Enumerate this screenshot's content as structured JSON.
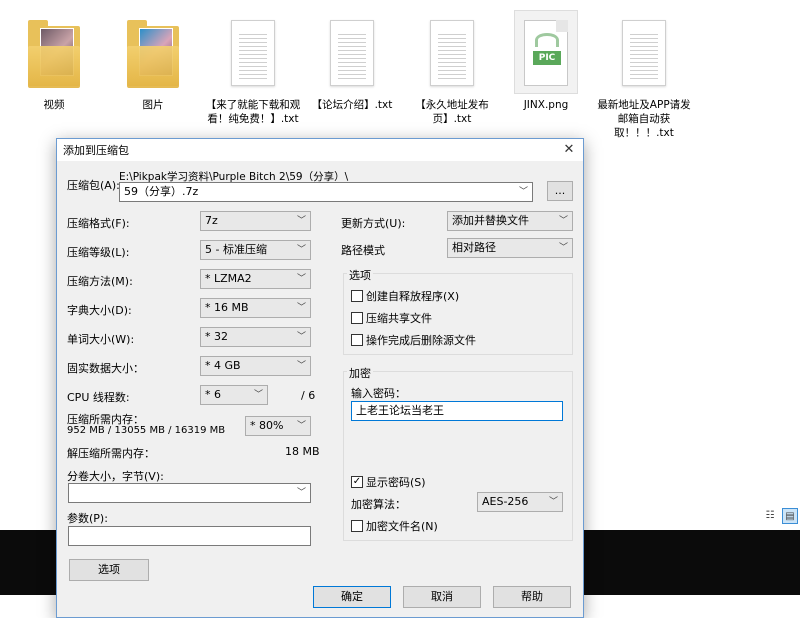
{
  "desktop": {
    "files": [
      {
        "name": "视频",
        "type": "folder"
      },
      {
        "name": "图片",
        "type": "folder"
      },
      {
        "name": "【来了就能下载和观看！纯免费！】.txt",
        "type": "txt"
      },
      {
        "name": "【论坛介绍】.txt",
        "type": "txt"
      },
      {
        "name": "【永久地址发布页】.txt",
        "type": "txt"
      },
      {
        "name": "JINX.png",
        "type": "png",
        "badge": "PIC"
      },
      {
        "name": "最新地址及APP请发邮箱自动获取！！！.txt",
        "type": "txt"
      }
    ]
  },
  "dialog": {
    "title": "添加到压缩包",
    "close": "✕",
    "archive_label": "压缩包(A):",
    "archive_path": "E:\\Pikpak学习资料\\Purple Bitch 2\\59（分享）\\",
    "archive_name": "59（分享）.7z",
    "browse": "...",
    "left": {
      "format_label": "压缩格式(F):",
      "format_value": "7z",
      "level_label": "压缩等级(L):",
      "level_value": "5 - 标准压缩",
      "method_label": "压缩方法(M):",
      "method_value": "* LZMA2",
      "dict_label": "字典大小(D):",
      "dict_value": "* 16 MB",
      "word_label": "单词大小(W):",
      "word_value": "* 32",
      "solid_label": "固实数据大小：",
      "solid_value": "* 4 GB",
      "cpu_label": "CPU 线程数:",
      "cpu_value": "* 6",
      "cpu_total": "/ 6",
      "mem_label": "压缩所需内存：",
      "mem_detail": "952 MB / 13055 MB / 16319 MB",
      "mem_value": "* 80%",
      "decomp_label": "解压缩所需内存：",
      "decomp_value": "18 MB",
      "split_label": "分卷大小，字节(V):",
      "split_value": "",
      "params_label": "参数(P):",
      "params_value": "",
      "options_btn": "选项"
    },
    "right": {
      "update_label": "更新方式(U):",
      "update_value": "添加并替换文件",
      "path_label": "路径模式",
      "path_value": "相对路径",
      "options_title": "选项",
      "opt_sfx": "创建自释放程序(X)",
      "opt_shared": "压缩共享文件",
      "opt_delete": "操作完成后删除源文件",
      "encrypt_title": "加密",
      "password_label": "输入密码：",
      "password_value": "上老王论坛当老王",
      "show_password": "显示密码(S)",
      "enc_method_label": "加密算法：",
      "enc_method_value": "AES-256",
      "encrypt_names": "加密文件名(N)"
    },
    "buttons": {
      "ok": "确定",
      "cancel": "取消",
      "help": "帮助"
    }
  }
}
